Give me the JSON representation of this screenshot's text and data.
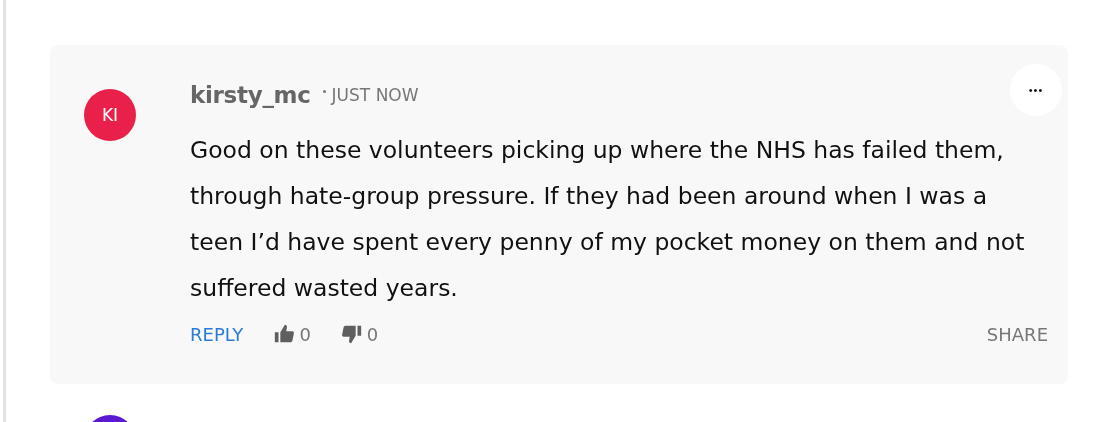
{
  "comments": [
    {
      "kind": "full",
      "avatar": {
        "initials": "KI",
        "color": "#e8204a"
      },
      "username": "kirsty_mc",
      "time": "JUST NOW",
      "menu": "•••",
      "body": "Good on these volunteers picking up where the NHS has failed them, through hate-group pressure. If they had been around when I was a teen I’d have spent every penny of my pocket money on them and not suffered wasted years.",
      "actions": {
        "reply": "REPLY",
        "likes": "0",
        "dislikes": "0",
        "share": "SHARE"
      }
    },
    {
      "kind": "partial",
      "avatar": {
        "color": "#5a1ad2"
      }
    }
  ]
}
